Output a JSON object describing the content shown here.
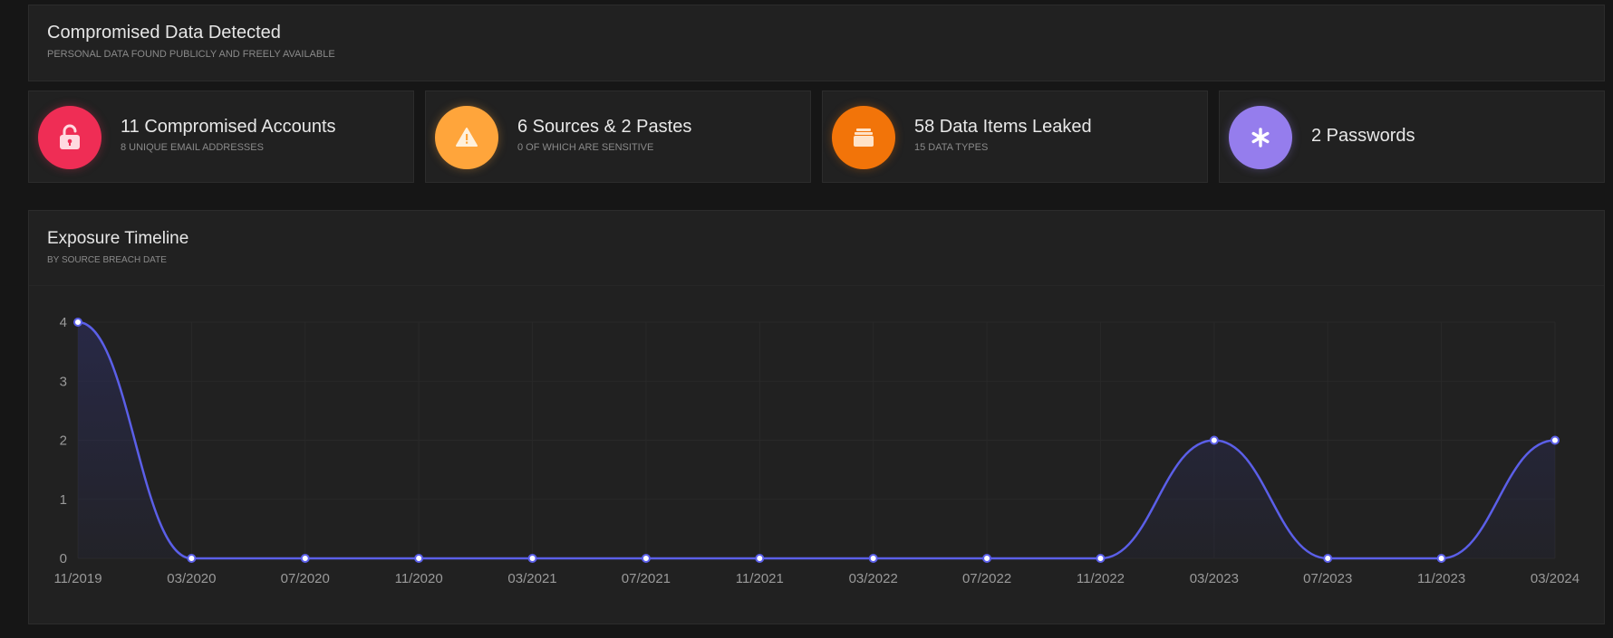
{
  "header": {
    "title": "Compromised Data Detected",
    "subtitle": "PERSONAL DATA FOUND PUBLICLY AND FREELY AVAILABLE"
  },
  "stats": [
    {
      "title": "11 Compromised Accounts",
      "subtitle": "8 UNIQUE EMAIL ADDRESSES",
      "icon": "unlock-icon",
      "color": "#ef2d55"
    },
    {
      "title": "6 Sources & 2 Pastes",
      "subtitle": "0 OF WHICH ARE SENSITIVE",
      "icon": "warning-icon",
      "color": "#ffa53b"
    },
    {
      "title": "58 Data Items Leaked",
      "subtitle": "15 DATA TYPES",
      "icon": "stack-icon",
      "color": "#f27409"
    },
    {
      "title": "2 Passwords",
      "subtitle": "",
      "icon": "asterisk-icon",
      "color": "#957ded"
    }
  ],
  "timeline": {
    "title": "Exposure Timeline",
    "subtitle": "BY SOURCE BREACH DATE"
  },
  "chart_data": {
    "type": "line",
    "x": [
      "11/2019",
      "03/2020",
      "07/2020",
      "11/2020",
      "03/2021",
      "07/2021",
      "11/2021",
      "03/2022",
      "07/2022",
      "11/2022",
      "03/2023",
      "07/2023",
      "11/2023",
      "03/2024"
    ],
    "values": [
      4,
      0,
      0,
      0,
      0,
      0,
      0,
      0,
      0,
      0,
      2,
      0,
      0,
      2
    ],
    "yticks": [
      0,
      1,
      2,
      3,
      4
    ],
    "ylim": [
      0,
      4
    ],
    "grid": true,
    "smooth": true,
    "line_color": "#5b5fe8",
    "fill_color": "#2a2b52"
  }
}
